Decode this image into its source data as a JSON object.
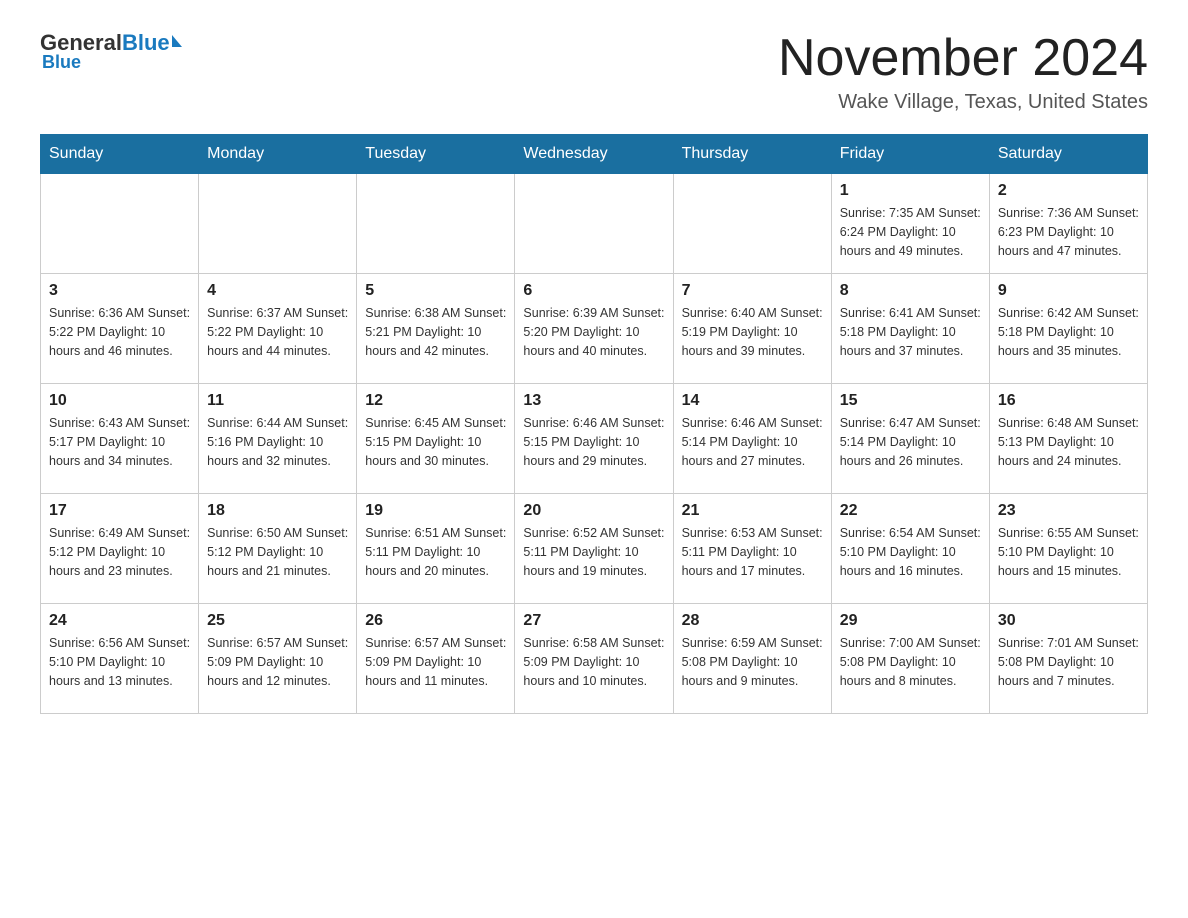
{
  "header": {
    "logo_general": "General",
    "logo_blue": "Blue",
    "title": "November 2024",
    "subtitle": "Wake Village, Texas, United States"
  },
  "days_of_week": [
    "Sunday",
    "Monday",
    "Tuesday",
    "Wednesday",
    "Thursday",
    "Friday",
    "Saturday"
  ],
  "weeks": [
    [
      {
        "day": "",
        "info": ""
      },
      {
        "day": "",
        "info": ""
      },
      {
        "day": "",
        "info": ""
      },
      {
        "day": "",
        "info": ""
      },
      {
        "day": "",
        "info": ""
      },
      {
        "day": "1",
        "info": "Sunrise: 7:35 AM\nSunset: 6:24 PM\nDaylight: 10 hours and 49 minutes."
      },
      {
        "day": "2",
        "info": "Sunrise: 7:36 AM\nSunset: 6:23 PM\nDaylight: 10 hours and 47 minutes."
      }
    ],
    [
      {
        "day": "3",
        "info": "Sunrise: 6:36 AM\nSunset: 5:22 PM\nDaylight: 10 hours and 46 minutes."
      },
      {
        "day": "4",
        "info": "Sunrise: 6:37 AM\nSunset: 5:22 PM\nDaylight: 10 hours and 44 minutes."
      },
      {
        "day": "5",
        "info": "Sunrise: 6:38 AM\nSunset: 5:21 PM\nDaylight: 10 hours and 42 minutes."
      },
      {
        "day": "6",
        "info": "Sunrise: 6:39 AM\nSunset: 5:20 PM\nDaylight: 10 hours and 40 minutes."
      },
      {
        "day": "7",
        "info": "Sunrise: 6:40 AM\nSunset: 5:19 PM\nDaylight: 10 hours and 39 minutes."
      },
      {
        "day": "8",
        "info": "Sunrise: 6:41 AM\nSunset: 5:18 PM\nDaylight: 10 hours and 37 minutes."
      },
      {
        "day": "9",
        "info": "Sunrise: 6:42 AM\nSunset: 5:18 PM\nDaylight: 10 hours and 35 minutes."
      }
    ],
    [
      {
        "day": "10",
        "info": "Sunrise: 6:43 AM\nSunset: 5:17 PM\nDaylight: 10 hours and 34 minutes."
      },
      {
        "day": "11",
        "info": "Sunrise: 6:44 AM\nSunset: 5:16 PM\nDaylight: 10 hours and 32 minutes."
      },
      {
        "day": "12",
        "info": "Sunrise: 6:45 AM\nSunset: 5:15 PM\nDaylight: 10 hours and 30 minutes."
      },
      {
        "day": "13",
        "info": "Sunrise: 6:46 AM\nSunset: 5:15 PM\nDaylight: 10 hours and 29 minutes."
      },
      {
        "day": "14",
        "info": "Sunrise: 6:46 AM\nSunset: 5:14 PM\nDaylight: 10 hours and 27 minutes."
      },
      {
        "day": "15",
        "info": "Sunrise: 6:47 AM\nSunset: 5:14 PM\nDaylight: 10 hours and 26 minutes."
      },
      {
        "day": "16",
        "info": "Sunrise: 6:48 AM\nSunset: 5:13 PM\nDaylight: 10 hours and 24 minutes."
      }
    ],
    [
      {
        "day": "17",
        "info": "Sunrise: 6:49 AM\nSunset: 5:12 PM\nDaylight: 10 hours and 23 minutes."
      },
      {
        "day": "18",
        "info": "Sunrise: 6:50 AM\nSunset: 5:12 PM\nDaylight: 10 hours and 21 minutes."
      },
      {
        "day": "19",
        "info": "Sunrise: 6:51 AM\nSunset: 5:11 PM\nDaylight: 10 hours and 20 minutes."
      },
      {
        "day": "20",
        "info": "Sunrise: 6:52 AM\nSunset: 5:11 PM\nDaylight: 10 hours and 19 minutes."
      },
      {
        "day": "21",
        "info": "Sunrise: 6:53 AM\nSunset: 5:11 PM\nDaylight: 10 hours and 17 minutes."
      },
      {
        "day": "22",
        "info": "Sunrise: 6:54 AM\nSunset: 5:10 PM\nDaylight: 10 hours and 16 minutes."
      },
      {
        "day": "23",
        "info": "Sunrise: 6:55 AM\nSunset: 5:10 PM\nDaylight: 10 hours and 15 minutes."
      }
    ],
    [
      {
        "day": "24",
        "info": "Sunrise: 6:56 AM\nSunset: 5:10 PM\nDaylight: 10 hours and 13 minutes."
      },
      {
        "day": "25",
        "info": "Sunrise: 6:57 AM\nSunset: 5:09 PM\nDaylight: 10 hours and 12 minutes."
      },
      {
        "day": "26",
        "info": "Sunrise: 6:57 AM\nSunset: 5:09 PM\nDaylight: 10 hours and 11 minutes."
      },
      {
        "day": "27",
        "info": "Sunrise: 6:58 AM\nSunset: 5:09 PM\nDaylight: 10 hours and 10 minutes."
      },
      {
        "day": "28",
        "info": "Sunrise: 6:59 AM\nSunset: 5:08 PM\nDaylight: 10 hours and 9 minutes."
      },
      {
        "day": "29",
        "info": "Sunrise: 7:00 AM\nSunset: 5:08 PM\nDaylight: 10 hours and 8 minutes."
      },
      {
        "day": "30",
        "info": "Sunrise: 7:01 AM\nSunset: 5:08 PM\nDaylight: 10 hours and 7 minutes."
      }
    ]
  ]
}
